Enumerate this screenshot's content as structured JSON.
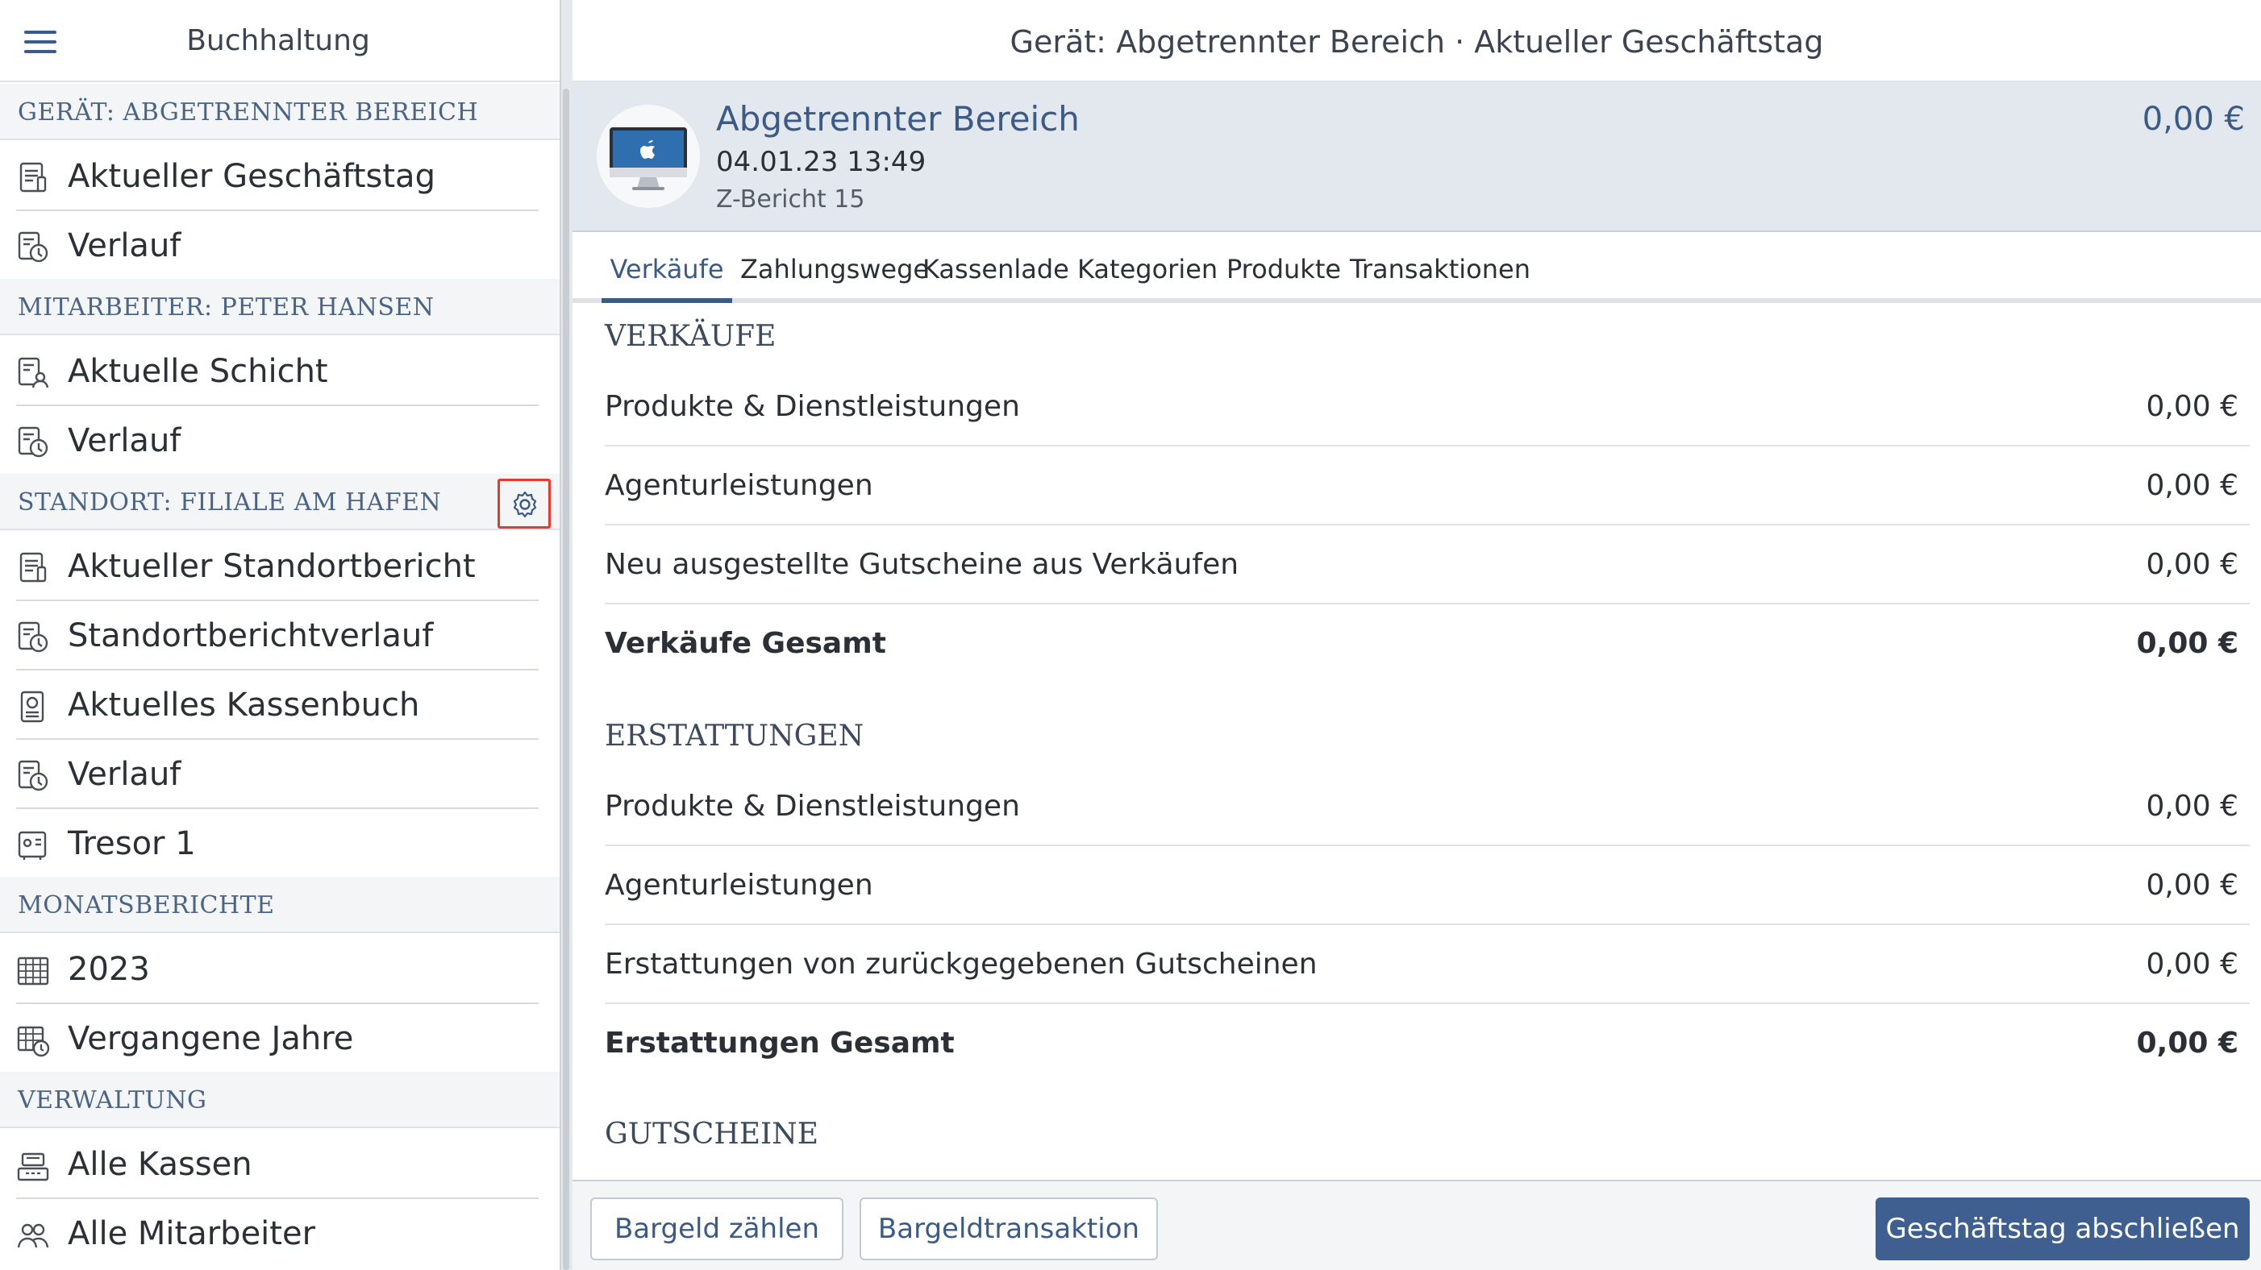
{
  "sidebar": {
    "title": "Buchhaltung",
    "sections": [
      {
        "header": "Gerät: Abgetrennter Bereich",
        "items": [
          {
            "label": "Aktueller Geschäftstag",
            "icon": "report-icon"
          },
          {
            "label": "Verlauf",
            "icon": "history-icon"
          }
        ]
      },
      {
        "header": "Mitarbeiter: Peter Hansen",
        "items": [
          {
            "label": "Aktuelle Schicht",
            "icon": "shift-report-icon"
          },
          {
            "label": "Verlauf",
            "icon": "history-icon"
          }
        ]
      },
      {
        "header": "Standort: Filiale am Hafen",
        "settings_icon": "gear-icon",
        "items": [
          {
            "label": "Aktueller Standortbericht",
            "icon": "report-icon"
          },
          {
            "label": "Standortberichtverlauf",
            "icon": "history-icon"
          },
          {
            "label": "Aktuelles Kassenbuch",
            "icon": "cashbook-icon"
          },
          {
            "label": "Verlauf",
            "icon": "history-icon"
          },
          {
            "label": "Tresor 1",
            "icon": "safe-icon"
          }
        ]
      },
      {
        "header": "Monatsberichte",
        "items": [
          {
            "label": "2023",
            "icon": "calendar-icon"
          },
          {
            "label": "Vergangene Jahre",
            "icon": "calendar-history-icon"
          }
        ]
      },
      {
        "header": "Verwaltung",
        "items": [
          {
            "label": "Alle Kassen",
            "icon": "register-icon"
          },
          {
            "label": "Alle Mitarbeiter",
            "icon": "users-icon"
          }
        ]
      }
    ]
  },
  "topbar": {
    "title": "Gerät: Abgetrennter Bereich · Aktueller Geschäftstag"
  },
  "device": {
    "name": "Abgetrennter Bereich",
    "datetime": "04.01.23 13:49",
    "report": "Z-Bericht 15",
    "amount": "0,00 €",
    "icon": "imac-icon"
  },
  "tabs": [
    {
      "label": "Verkäufe",
      "active": true
    },
    {
      "label": "Zahlungswege"
    },
    {
      "label": "Kassenlade"
    },
    {
      "label": "Kategorien"
    },
    {
      "label": "Produkte"
    },
    {
      "label": "Transaktionen"
    }
  ],
  "content": {
    "sections": [
      {
        "title": "Verkäufe",
        "rows": [
          {
            "label": "Produkte & Dienstleistungen",
            "value": "0,00 €"
          },
          {
            "label": "Agenturleistungen",
            "value": "0,00 €"
          },
          {
            "label": "Neu ausgestellte Gutscheine aus Verkäufen",
            "value": "0,00 €"
          },
          {
            "label": "Verkäufe Gesamt",
            "value": "0,00 €",
            "total": true
          }
        ]
      },
      {
        "title": "Erstattungen",
        "rows": [
          {
            "label": "Produkte & Dienstleistungen",
            "value": "0,00 €"
          },
          {
            "label": "Agenturleistungen",
            "value": "0,00 €"
          },
          {
            "label": "Erstattungen von zurückgegebenen Gutscheinen",
            "value": "0,00 €"
          },
          {
            "label": "Erstattungen Gesamt",
            "value": "0,00 €",
            "total": true
          }
        ]
      },
      {
        "title": "Gutscheine",
        "rows": []
      }
    ]
  },
  "actions": {
    "count_cash": "Bargeld zählen",
    "cash_transaction": "Bargeldtransaktion",
    "close_day": "Geschäftstag abschließen"
  },
  "colors": {
    "accent": "#3a5a88",
    "primary_button": "#3e5f8f",
    "highlight_border": "#e53a2e",
    "card_background": "#e3e8ee"
  }
}
